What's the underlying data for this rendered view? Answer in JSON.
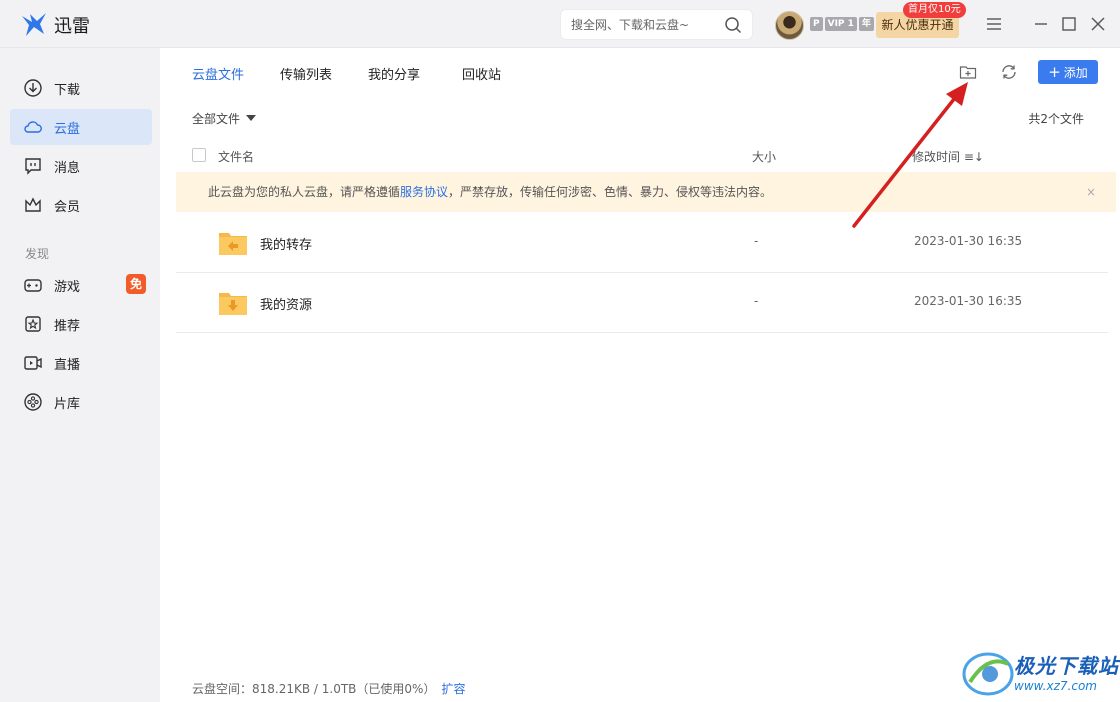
{
  "app": {
    "title": "迅雷"
  },
  "search": {
    "placeholder": "搜全网、下载和云盘~"
  },
  "account": {
    "vip_badges": [
      "P",
      "VIP 1",
      "年"
    ],
    "promo_label": "新人优惠开通",
    "promo_tag": "首月仅10元"
  },
  "sidebar": {
    "items": [
      {
        "label": "下载",
        "icon": "download-icon"
      },
      {
        "label": "云盘",
        "icon": "cloud-icon",
        "active": true
      },
      {
        "label": "消息",
        "icon": "message-icon"
      },
      {
        "label": "会员",
        "icon": "crown-icon"
      }
    ],
    "section_label": "发现",
    "discover_items": [
      {
        "label": "游戏",
        "icon": "gamepad-icon",
        "badge": "免"
      },
      {
        "label": "推荐",
        "icon": "star-icon"
      },
      {
        "label": "直播",
        "icon": "live-icon"
      },
      {
        "label": "片库",
        "icon": "film-reel-icon"
      }
    ]
  },
  "tabs": [
    "云盘文件",
    "传输列表",
    "我的分享",
    "回收站"
  ],
  "toolbar": {
    "add_label": "添加"
  },
  "filter": {
    "label": "全部文件"
  },
  "file_count": "共2个文件",
  "columns": {
    "name": "文件名",
    "size": "大小",
    "modified": "修改时间 ≡↓"
  },
  "notice": {
    "before": "此云盘为您的私人云盘，请严格遵循",
    "link": "服务协议",
    "after": "，严禁存放，传输任何涉密、色情、暴力、侵权等违法内容。",
    "close": "×"
  },
  "files": [
    {
      "name": "我的转存",
      "size": "-",
      "modified": "2023-01-30 16:35",
      "icon": "folder-transfer-icon"
    },
    {
      "name": "我的资源",
      "size": "-",
      "modified": "2023-01-30 16:35",
      "icon": "folder-download-icon"
    }
  ],
  "storage": {
    "text": "云盘空间：818.21KB / 1.0TB（已使用0%）",
    "expand": "扩容"
  },
  "watermark": {
    "title": "极光下载站",
    "url": "www.xz7.com"
  },
  "colors": {
    "accent": "#3a7bf0",
    "notice_bg": "#fff4e0",
    "folder": "#f7b84a",
    "arrow": "#d42020"
  }
}
